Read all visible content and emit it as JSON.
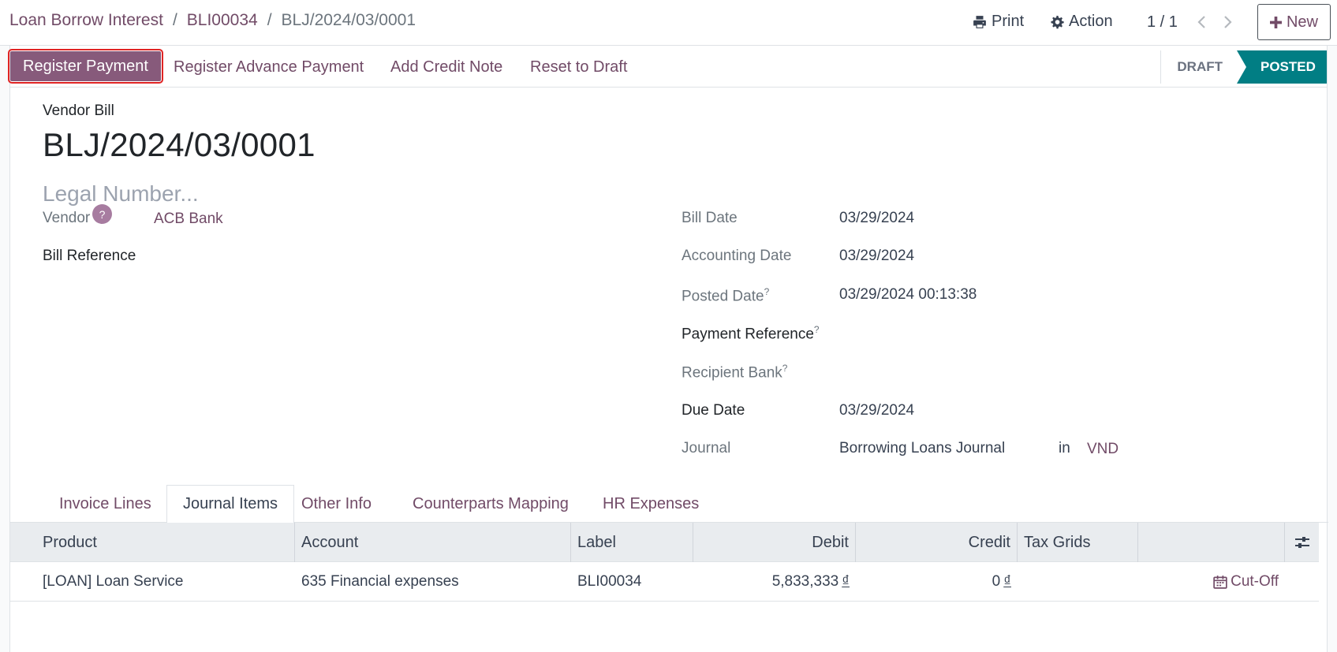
{
  "breadcrumb": {
    "items": [
      "Loan Borrow Interest",
      "BLI00034"
    ],
    "current": "BLJ/2024/03/0001",
    "separator": "/"
  },
  "control_panel": {
    "print_label": "Print",
    "action_label": "Action",
    "pager": "1 / 1",
    "new_label": "New"
  },
  "statusbar": {
    "buttons": {
      "register_payment": "Register Payment",
      "register_advance_payment": "Register Advance Payment",
      "add_credit_note": "Add Credit Note",
      "reset_to_draft": "Reset to Draft"
    },
    "stages": {
      "draft": "DRAFT",
      "posted": "POSTED"
    },
    "active_stage": "POSTED"
  },
  "form": {
    "doc_type": "Vendor Bill",
    "name": "BLJ/2024/03/0001",
    "legal_number_placeholder": "Legal Number...",
    "left": {
      "vendor_label": "Vendor",
      "vendor_help": "?",
      "vendor_value": "ACB Bank",
      "bill_reference_label": "Bill Reference"
    },
    "right": {
      "bill_date_label": "Bill Date",
      "bill_date_value": "03/29/2024",
      "accounting_date_label": "Accounting Date",
      "accounting_date_value": "03/29/2024",
      "posted_date_label": "Posted Date",
      "posted_date_value": "03/29/2024 00:13:38",
      "payment_reference_label": "Payment Reference",
      "recipient_bank_label": "Recipient Bank",
      "due_date_label": "Due Date",
      "due_date_value": "03/29/2024",
      "journal_label": "Journal",
      "journal_value": "Borrowing Loans Journal",
      "journal_in": "in",
      "journal_currency": "VND",
      "help_mark": "?"
    }
  },
  "tabs": [
    "Invoice Lines",
    "Journal Items",
    "Other Info",
    "Counterparts Mapping",
    "HR Expenses"
  ],
  "active_tab": "Journal Items",
  "table": {
    "columns": [
      "Product",
      "Account",
      "Label",
      "Debit",
      "Credit",
      "Tax Grids"
    ],
    "rows": [
      {
        "product": "[LOAN] Loan Service",
        "account": "635 Financial expenses",
        "label": "BLI00034",
        "debit": "5,833,333",
        "credit": "0",
        "currency_symbol": "₫",
        "action": "Cut-Off"
      }
    ]
  },
  "colors": {
    "brand_purple": "#714b67",
    "button_purple": "#875a7b",
    "stage_active": "#017e84",
    "highlight_outline": "#e02424"
  }
}
